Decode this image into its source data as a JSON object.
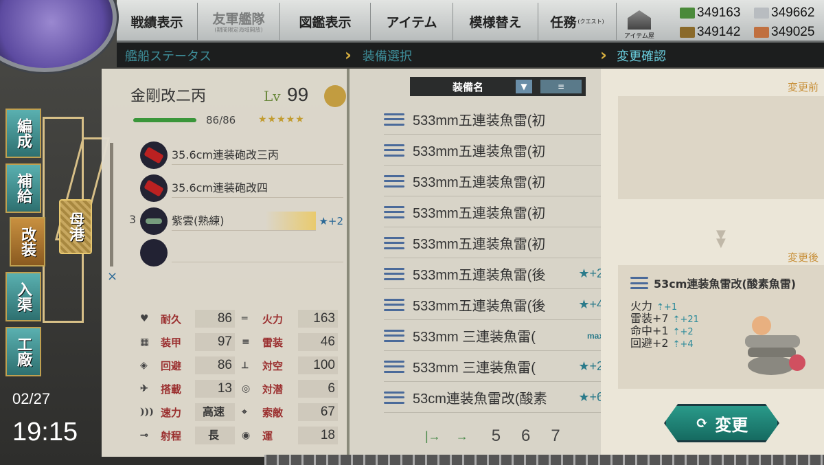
{
  "topbar": {
    "menu": [
      {
        "label": "戦績表示",
        "sub": ""
      },
      {
        "label": "友軍艦隊",
        "sub": "(期間限定海域開放)"
      },
      {
        "label": "図鑑表示",
        "sub": ""
      },
      {
        "label": "アイテム",
        "sub": ""
      },
      {
        "label": "模様替え",
        "sub": ""
      },
      {
        "label": "任務",
        "sub": "(クエスト)"
      }
    ],
    "item_shop": "アイテム屋",
    "resources": {
      "fuel": "349163",
      "steel": "349662",
      "ammo": "349142",
      "bauxite": "349025"
    }
  },
  "breadcrumbs": {
    "ship_status": "艦船ステータス",
    "equip_select": "装備選択",
    "change_confirm": "変更確認"
  },
  "sidebar": {
    "items": [
      "編成",
      "補給",
      "改装",
      "入渠",
      "工廠"
    ],
    "port": "母港",
    "date": "02/27",
    "time": "19:15"
  },
  "ship": {
    "name": "金剛改二丙",
    "lv_label": "Lv",
    "lv": "99",
    "hp": "86/86",
    "stars": "★★★★★",
    "slots": [
      {
        "name": "35.6cm連装砲改三丙",
        "extra": "",
        "icon": "main-gun"
      },
      {
        "name": "35.6cm連装砲改四",
        "extra": "",
        "icon": "main-gun"
      },
      {
        "name": "紫雲(熟練)",
        "extra": "★+2",
        "icon": "seaplane",
        "count": "3"
      },
      {
        "name": "",
        "extra": "",
        "icon": "empty"
      }
    ],
    "stats": [
      {
        "label": "耐久",
        "value": "86"
      },
      {
        "label": "火力",
        "value": "163"
      },
      {
        "label": "装甲",
        "value": "97"
      },
      {
        "label": "雷装",
        "value": "46"
      },
      {
        "label": "回避",
        "value": "86"
      },
      {
        "label": "対空",
        "value": "100"
      },
      {
        "label": "搭載",
        "value": "13"
      },
      {
        "label": "対潜",
        "value": "6"
      },
      {
        "label": "速力",
        "value": "高速"
      },
      {
        "label": "索敵",
        "value": "67"
      },
      {
        "label": "射程",
        "value": "長"
      },
      {
        "label": "運",
        "value": "18"
      }
    ]
  },
  "equip_list": {
    "header": "装備名",
    "rows": [
      {
        "name": "533mm五連装魚雷(初",
        "imp": ""
      },
      {
        "name": "533mm五連装魚雷(初",
        "imp": ""
      },
      {
        "name": "533mm五連装魚雷(初",
        "imp": ""
      },
      {
        "name": "533mm五連装魚雷(初",
        "imp": ""
      },
      {
        "name": "533mm五連装魚雷(初",
        "imp": ""
      },
      {
        "name": "533mm五連装魚雷(後",
        "imp": "★+2"
      },
      {
        "name": "533mm五連装魚雷(後",
        "imp": "★+4"
      },
      {
        "name": "533mm 三連装魚雷(",
        "imp": "max"
      },
      {
        "name": "533mm 三連装魚雷(",
        "imp": "★+2"
      },
      {
        "name": "53cm連装魚雷改(酸素",
        "imp": "★+6"
      }
    ],
    "pages": [
      "5",
      "6",
      "7"
    ]
  },
  "confirm": {
    "before_label": "変更前",
    "after_label": "変更後",
    "after_name": "53cm連装魚雷改(酸素魚雷)",
    "after_stats": [
      {
        "label": "火力",
        "inc": "+1"
      },
      {
        "label": "雷装+7",
        "inc": "+21"
      },
      {
        "label": "命中+1",
        "inc": "+2"
      },
      {
        "label": "回避+2",
        "inc": "+4"
      }
    ],
    "change_button": "変更"
  }
}
